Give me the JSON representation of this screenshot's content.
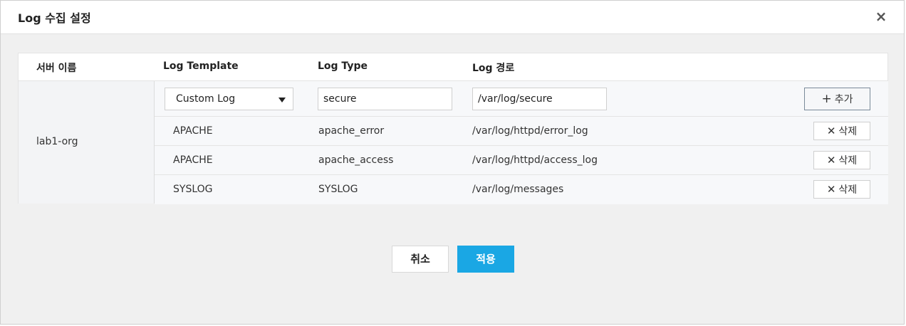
{
  "dialog": {
    "title": "Log 수집 설정",
    "close_icon": "×"
  },
  "table": {
    "headers": {
      "server_name": "서버 이름",
      "log_template": "Log Template",
      "log_type": "Log Type",
      "log_path": "Log 경로"
    },
    "server": "lab1-org",
    "input_row": {
      "template_selected": "Custom Log",
      "log_type_value": "secure",
      "log_path_value": "/var/log/secure",
      "add_label": "추가"
    },
    "rows": [
      {
        "template": "APACHE",
        "type": "apache_error",
        "path": "/var/log/httpd/error_log",
        "delete_label": "삭제"
      },
      {
        "template": "APACHE",
        "type": "apache_access",
        "path": "/var/log/httpd/access_log",
        "delete_label": "삭제"
      },
      {
        "template": "SYSLOG",
        "type": "SYSLOG",
        "path": "/var/log/messages",
        "delete_label": "삭제"
      }
    ]
  },
  "footer": {
    "cancel_label": "취소",
    "apply_label": "적용"
  },
  "colors": {
    "accent": "#1aa7e4",
    "background": "#f0f0f0"
  },
  "icons": {
    "close": "close-icon",
    "add": "plus-icon",
    "delete": "x-icon",
    "dropdown": "chevron-down-icon"
  }
}
